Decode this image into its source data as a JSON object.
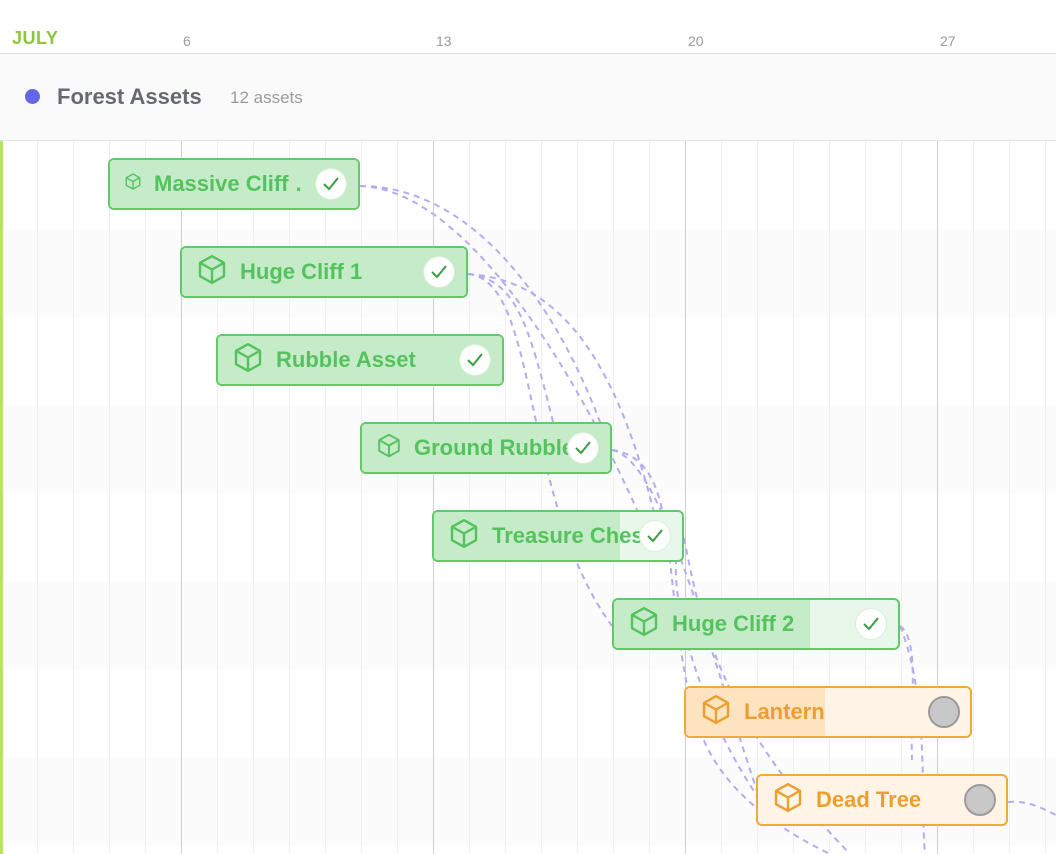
{
  "timeline": {
    "month": "JULY",
    "days": [
      "6",
      "13",
      "20",
      "27"
    ]
  },
  "group": {
    "name": "Forest Assets",
    "count_label": "12 assets",
    "color": "#6466e6"
  },
  "colors": {
    "done": "#62c96a",
    "in_progress": "#f0a93a",
    "dependency": "#b3adf0",
    "today": "#b6e36c"
  },
  "tasks": [
    {
      "label": "Massive Cliff …",
      "status": "done",
      "icon": "cube-icon",
      "progress": 100
    },
    {
      "label": "Huge Cliff 1",
      "status": "done",
      "icon": "cube-icon",
      "progress": 100
    },
    {
      "label": "Rubble Asset",
      "status": "done",
      "icon": "cube-icon",
      "progress": 100
    },
    {
      "label": "Ground Rubble",
      "status": "done",
      "icon": "cube-icon",
      "progress": 100
    },
    {
      "label": "Treasure Chest",
      "status": "done",
      "icon": "cube-icon",
      "progress": 75
    },
    {
      "label": "Huge Cliff 2",
      "status": "done",
      "icon": "cube-icon",
      "progress": 69
    },
    {
      "label": "Lantern",
      "status": "in-progress",
      "icon": "cube-icon",
      "progress": 49
    },
    {
      "label": "Dead Tree",
      "status": "in-progress",
      "icon": "cube-icon",
      "progress": 0
    }
  ]
}
